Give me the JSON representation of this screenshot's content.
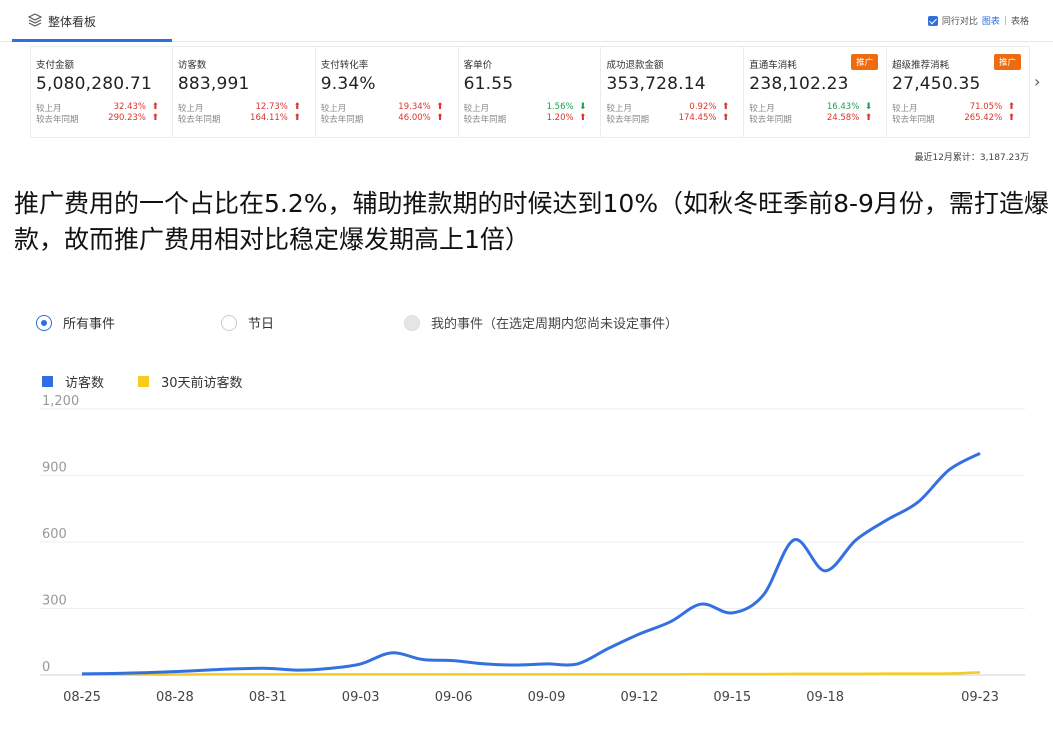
{
  "header": {
    "title": "整体看板",
    "compare_label": "同行对比",
    "view_chart": "图表",
    "view_sep": "|",
    "view_table": "表格"
  },
  "cards": [
    {
      "label": "支付金额",
      "value": "5,080,280.71",
      "mom_label": "较上月",
      "mom": "32.43%",
      "mom_dir": "up",
      "yoy_label": "较去年同期",
      "yoy": "290.23%",
      "yoy_dir": "up",
      "badge": ""
    },
    {
      "label": "访客数",
      "value": "883,991",
      "mom_label": "较上月",
      "mom": "12.73%",
      "mom_dir": "up",
      "yoy_label": "较去年同期",
      "yoy": "164.11%",
      "yoy_dir": "up",
      "badge": ""
    },
    {
      "label": "支付转化率",
      "value": "9.34%",
      "mom_label": "较上月",
      "mom": "19.34%",
      "mom_dir": "up",
      "yoy_label": "较去年同期",
      "yoy": "46.00%",
      "yoy_dir": "up",
      "badge": ""
    },
    {
      "label": "客单价",
      "value": "61.55",
      "mom_label": "较上月",
      "mom": "1.56%",
      "mom_dir": "down",
      "yoy_label": "较去年同期",
      "yoy": "1.20%",
      "yoy_dir": "up",
      "badge": ""
    },
    {
      "label": "成功退款金额",
      "value": "353,728.14",
      "mom_label": "较上月",
      "mom": "0.92%",
      "mom_dir": "up",
      "yoy_label": "较去年同期",
      "yoy": "174.45%",
      "yoy_dir": "up",
      "badge": ""
    },
    {
      "label": "直通车消耗",
      "value": "238,102.23",
      "mom_label": "较上月",
      "mom": "16.43%",
      "mom_dir": "down",
      "yoy_label": "较去年同期",
      "yoy": "24.58%",
      "yoy_dir": "up",
      "badge": "推广"
    },
    {
      "label": "超级推荐消耗",
      "value": "27,450.35",
      "mom_label": "较上月",
      "mom": "71.05%",
      "mom_dir": "up",
      "yoy_label": "较去年同期",
      "yoy": "265.42%",
      "yoy_dir": "up",
      "badge": "推广"
    }
  ],
  "total_note": "最近12月累计：3,187.23万",
  "overlay_text": "推广费用的一个占比在5.2%，辅助推款期的时候达到10%（如秋冬旺季前8-9月份，需打造爆款，故而推广费用相对比稳定爆发期高上1倍）",
  "events": [
    {
      "label": "所有事件",
      "state": "on"
    },
    {
      "label": "节日",
      "state": "off"
    },
    {
      "label": "我的事件（在选定周期内您尚未设定事件）",
      "state": "disabled"
    }
  ],
  "colors": {
    "accent": "#2f6fde",
    "up": "#e0322c",
    "down": "#1aa151",
    "badge": "#ee6b0f",
    "series1": "#3370e0",
    "series2": "#f5cc1f"
  },
  "chart_data": {
    "type": "line",
    "x": [
      "08-25",
      "08-26",
      "08-27",
      "08-28",
      "08-29",
      "08-30",
      "08-31",
      "09-01",
      "09-02",
      "09-03",
      "09-04",
      "09-05",
      "09-06",
      "09-07",
      "09-08",
      "09-09",
      "09-10",
      "09-11",
      "09-12",
      "09-13",
      "09-14",
      "09-15",
      "09-16",
      "09-17",
      "09-18",
      "09-19",
      "09-20",
      "09-21",
      "09-22",
      "09-23"
    ],
    "xticks": [
      "08-25",
      "08-28",
      "08-31",
      "09-03",
      "09-06",
      "09-09",
      "09-12",
      "09-15",
      "09-18",
      "09-23"
    ],
    "yticks": [
      0,
      300,
      600,
      900,
      1200
    ],
    "ytick_labels": [
      "0",
      "300",
      "600",
      "900",
      "1,200"
    ],
    "ylim": [
      0,
      1200
    ],
    "grid": true,
    "legend": "top-left",
    "series": [
      {
        "name": "访客数",
        "values": [
          5,
          7,
          10,
          15,
          22,
          28,
          30,
          22,
          30,
          50,
          100,
          70,
          65,
          50,
          45,
          50,
          50,
          120,
          185,
          240,
          320,
          280,
          360,
          610,
          470,
          610,
          700,
          780,
          925,
          1000
        ]
      },
      {
        "name": "30天前访客数",
        "values": [
          2,
          2,
          2,
          2,
          3,
          3,
          3,
          3,
          3,
          3,
          3,
          3,
          3,
          3,
          3,
          3,
          3,
          3,
          3,
          3,
          4,
          4,
          4,
          5,
          5,
          5,
          6,
          6,
          7,
          12
        ]
      }
    ]
  }
}
